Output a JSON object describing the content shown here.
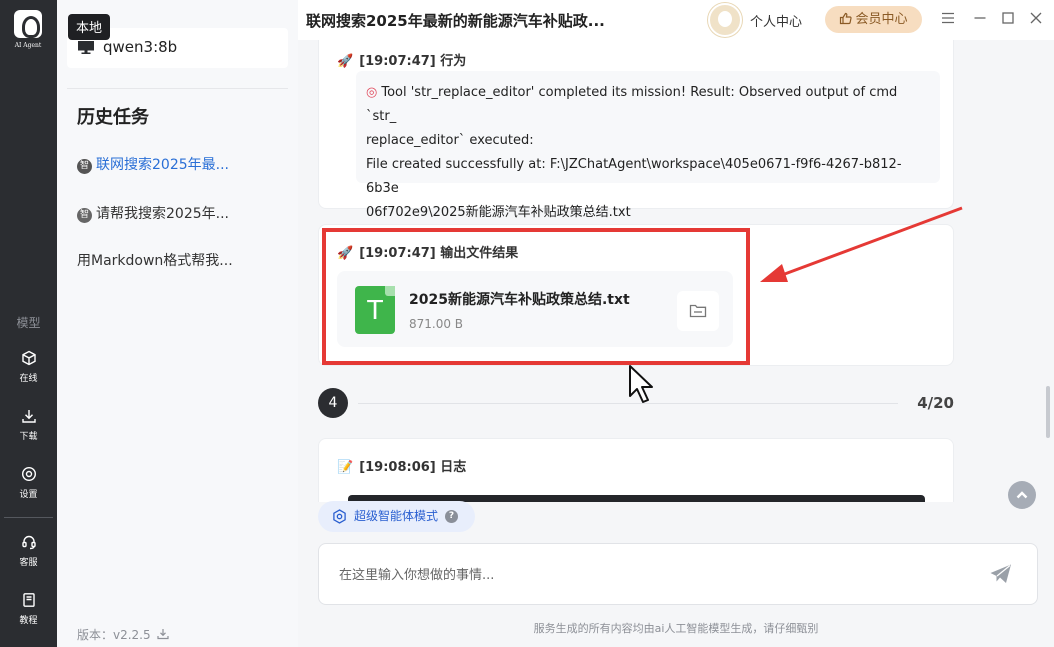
{
  "rail": {
    "logo_text": "AI Agent",
    "section_label": "模型",
    "items": [
      {
        "label": "在线",
        "icon": "cube-icon"
      },
      {
        "label": "下载",
        "icon": "download-icon"
      },
      {
        "label": "设置",
        "icon": "settings-icon"
      },
      {
        "label": "客服",
        "icon": "headset-icon"
      },
      {
        "label": "教程",
        "icon": "book-icon"
      }
    ]
  },
  "sidebar": {
    "local_tag": "本地",
    "model_name": "qwen3:8b",
    "history_title": "历史任务",
    "history": [
      {
        "label": "联网搜索2025年最...",
        "badge": "智",
        "active": true
      },
      {
        "label": "请帮我搜索2025年...",
        "badge": "智",
        "active": false
      },
      {
        "label": "用Markdown格式帮我...",
        "badge": "",
        "active": false
      }
    ],
    "version": "版本：v2.2.5"
  },
  "header": {
    "title": "联网搜索2025年最新的新能源汽车补贴政...",
    "user_center": "个人中心",
    "vip_label": "会员中心"
  },
  "messages": {
    "action": {
      "head": "[19:07:47] 行为",
      "line1": "Tool 'str_replace_editor' completed its mission! Result: Observed output of cmd `str_",
      "line2": "replace_editor` executed:",
      "line3": "File created successfully at: F:\\JZChatAgent\\workspace\\405e0671-f9f6-4267-b812-6b3e",
      "line4": "06f702e9\\2025新能源汽车补贴政策总结.txt"
    },
    "output": {
      "head": "[19:07:47] 输出文件结果",
      "file_letter": "T",
      "file_name": "2025新能源汽车补贴政策总结.txt",
      "file_size": "871.00 B"
    },
    "step": {
      "number": "4",
      "count": "4/20"
    },
    "log": {
      "head": "[19:08:06] 日志"
    }
  },
  "composer": {
    "mode_label": "超级智能体模式",
    "help": "?",
    "placeholder": "在这里输入你想做的事情..."
  },
  "footer": {
    "note": "服务生成的所有内容均由ai人工智能模型生成，请仔细甄别"
  },
  "colors": {
    "accent": "#2a6fd6",
    "highlight": "#e53935",
    "file_icon": "#3fb54b",
    "rail_bg": "#2b2d31",
    "vip_bg": "#f7ddc0"
  }
}
